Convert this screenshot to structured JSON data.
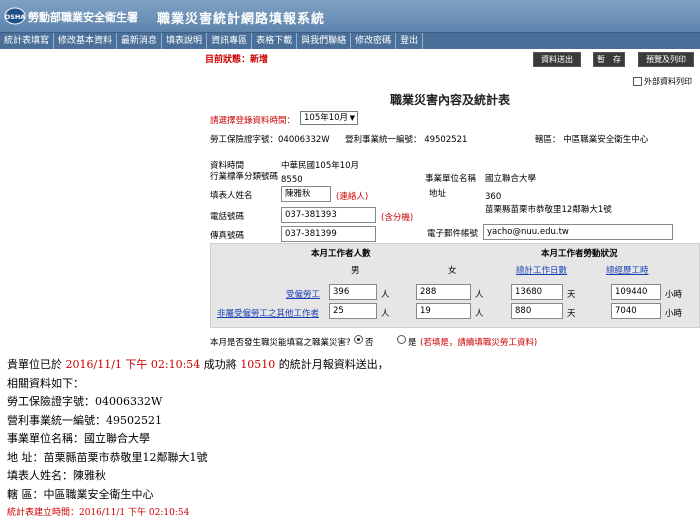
{
  "header": {
    "logo_text": "OSHA",
    "agency": "勞動部職業安全衛生署",
    "title": "職業災害統計網路填報系統"
  },
  "nav": [
    "統計表填寫",
    "修改基本資料",
    "最新消息",
    "填表說明",
    "資訊專區",
    "表格下載",
    "與我們聯絡",
    "修改密碼",
    "登出"
  ],
  "status": "目前狀態：新增",
  "toolbar": {
    "send": "資料送出",
    "pause": "暫　存",
    "preview": "預覽及列印",
    "external_print": "外部資料列印"
  },
  "form": {
    "title": "職業災害內容及統計表",
    "period_label": "請選擇登錄資料時間：",
    "period_value": "105年10月",
    "insurance_label": "勞工保險證字號：04006332W",
    "business_label": "營利事業統一編號： 49502521",
    "district_label": "轄區： 中區職業安全衛生中心",
    "data_time_label": "資料時間",
    "data_time_value": "中華民國105年10月",
    "industry_label": "行業標準分類號碼",
    "industry_value": "8550",
    "unit_name_label": "事業單位名稱",
    "unit_name_value": "國立聯合大學",
    "filler_label": "填表人姓名",
    "filler_value": "陳雅秋",
    "contact_tag": "(連絡人)",
    "address_label": "地址",
    "address_zip": "360",
    "address_value": "苗栗縣苗栗市恭敬里12鄰聯大1號",
    "phone_label": "電話號碼",
    "phone_value": "037-381393",
    "ext_tag": "(含分機)",
    "fax_label": "傳真號碼",
    "fax_value": "037-381399",
    "email_label": "電子郵件帳號",
    "email_value": "yacho@nuu.edu.tw"
  },
  "labor": {
    "workers_header": "本月工作者人數",
    "status_header": "本月工作者勞動狀況",
    "male": "男",
    "female": "女",
    "total_days_link": "總計工作日數",
    "total_hours_link": "總經歷工時",
    "row1_label": "受僱勞工",
    "row1_male": "396",
    "row1_female": "288",
    "row1_days": "13680",
    "row1_hours": "109440",
    "row2_label": "非屬受僱勞工之其他工作者",
    "row2_male": "25",
    "row2_female": "19",
    "row2_days": "880",
    "row2_hours": "7040",
    "unit_person": "人",
    "unit_day": "天",
    "unit_hour": "小時",
    "question": "本月是否發生職災能填寫之職業災害?",
    "no": "否",
    "yes": "是",
    "yes_note": "(若填是，請續填職災勞工資料)"
  },
  "message": {
    "line1_a": "貴單位已於 ",
    "line1_date": "2016/11/1 下午 02:10:54",
    "line1_b": " 成功將 ",
    "line1_id": "10510",
    "line1_c": " 的統計月報資料送出，",
    "line2": "相關資料如下：",
    "line3": "勞工保險證字號：04006332W",
    "line4": "營利事業統一編號：49502521",
    "line5": "事業單位名稱：國立聯合大學",
    "line6": "地 址：苗栗縣苗栗市恭敬里12鄰聯大1號",
    "line7": "填表人姓名：陳雅秋",
    "line8": "轄 區：中區職業安全衛生中心",
    "footer": "統計表建立時間：2016/11/1 下午 02:10:54"
  },
  "colors": {
    "header": "#6a8fb7",
    "nav": "#4a6f98",
    "alert": "#cc0000",
    "link": "#1a3fb5"
  }
}
